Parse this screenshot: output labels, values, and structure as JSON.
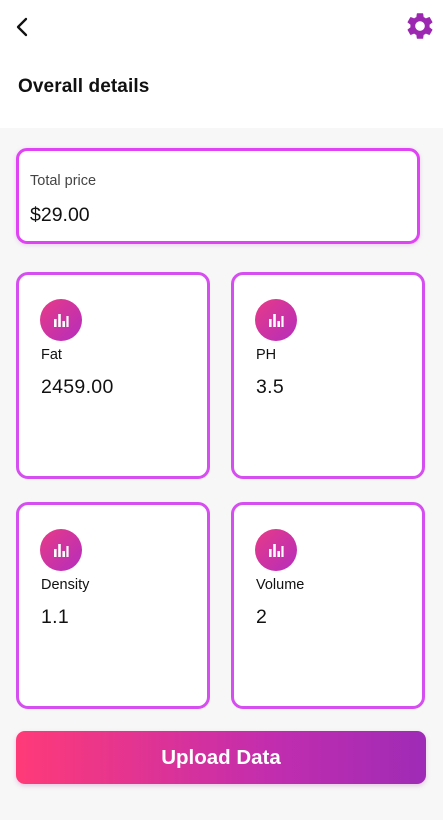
{
  "header": {
    "title": "Overall details",
    "back_icon": "chevron-left-icon",
    "settings_icon": "gear-icon"
  },
  "total": {
    "label": "Total price",
    "value": "$29.00"
  },
  "metrics": [
    {
      "label": "Fat",
      "value": "2459.00",
      "icon": "bar-chart-icon"
    },
    {
      "label": "PH",
      "value": "3.5",
      "icon": "bar-chart-icon"
    },
    {
      "label": "Density",
      "value": "1.1",
      "icon": "bar-chart-icon"
    },
    {
      "label": "Volume",
      "value": "2",
      "icon": "bar-chart-icon"
    }
  ],
  "actions": {
    "upload_label": "Upload Data"
  },
  "colors": {
    "accent": "#9c27b0",
    "card_border": "#df43f4",
    "gradient_start": "#ff3a78",
    "gradient_end": "#9f2bb6"
  }
}
